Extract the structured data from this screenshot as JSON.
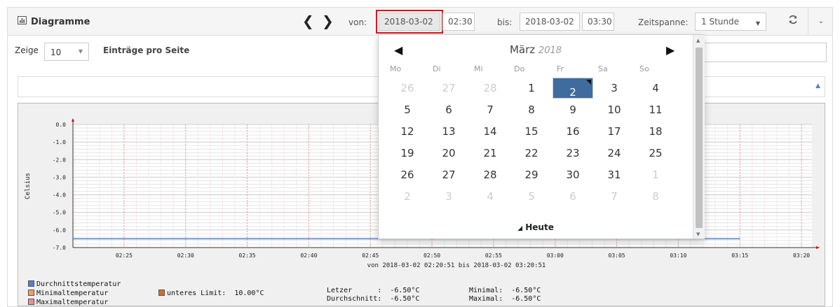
{
  "header": {
    "title": "Diagramme",
    "from_label": "von:",
    "from_date": "2018-03-02",
    "from_time": "02:30",
    "to_label": "bis:",
    "to_date": "2018-03-02",
    "to_time": "03:30",
    "span_label": "Zeitspanne:",
    "span_value": "1 Stunde"
  },
  "table": {
    "show_label": "Zeige",
    "page_size": "10",
    "entries_label": "Einträge pro Seite"
  },
  "chart_data": {
    "type": "line",
    "ylabel": "Celsius",
    "yticks": [
      "0.0",
      "-1.0",
      "-2.0",
      "-3.0",
      "-4.0",
      "-5.0",
      "-6.0",
      "-7.0"
    ],
    "ylim": [
      -7.0,
      0.0
    ],
    "xticks": [
      "02:25",
      "02:30",
      "02:35",
      "02:40",
      "02:45",
      "02:50",
      "02:55",
      "03:00",
      "03:05",
      "03:10",
      "03:15",
      "03:20"
    ],
    "xrange_label": "von 2018-03-02 02:20:51 bis 2018-03-02 03:20:51",
    "series": [
      {
        "name": "Durchnittstemperatur",
        "color": "#4f81d0",
        "start": "02:20:51",
        "end": "03:15",
        "value": -6.5
      },
      {
        "name": "Minimaltemperatur",
        "color": "#f0a060"
      },
      {
        "name": "Maximaltemperatur",
        "color": "#f08a9a"
      }
    ],
    "limit": {
      "name": "unteres Limit:",
      "value": "10.00°C",
      "color": "#e06a1a"
    },
    "stats": {
      "last_label": "Letzer      :",
      "last_value": "-6.50°C",
      "avg_label": "Durchschnitt:",
      "avg_value": "-6.50°C",
      "min_label": "Minimal:",
      "min_value": "-6.50°C",
      "max_label": "Maximal:",
      "max_value": "-6.50°C"
    },
    "grid": true
  },
  "datepicker": {
    "month": "März",
    "year": "2018",
    "weekdays": [
      "Mo",
      "Di",
      "Mi",
      "Do",
      "Fr",
      "Sa",
      "So"
    ],
    "weeks": [
      [
        "26",
        "27",
        "28",
        "1",
        "2",
        "3",
        "4"
      ],
      [
        "5",
        "6",
        "7",
        "8",
        "9",
        "10",
        "11"
      ],
      [
        "12",
        "13",
        "14",
        "15",
        "16",
        "17",
        "18"
      ],
      [
        "19",
        "20",
        "21",
        "22",
        "23",
        "24",
        "25"
      ],
      [
        "26",
        "27",
        "28",
        "29",
        "30",
        "31",
        "1"
      ],
      [
        "2",
        "3",
        "4",
        "5",
        "6",
        "7",
        "8"
      ]
    ],
    "selected": "2",
    "today_label": "Heute"
  }
}
